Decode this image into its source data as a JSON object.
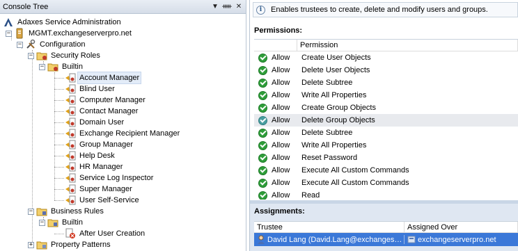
{
  "console_tree": {
    "title": "Console Tree",
    "buttons": {
      "dropdown": "▼",
      "pin": "ᚔ",
      "close": "✕"
    },
    "nodes": [
      {
        "label": "Adaxes Service Administration",
        "icon": "adaxes-logo-icon"
      },
      {
        "label": "MGMT.exchangeserverpro.net",
        "icon": "server-icon"
      },
      {
        "label": "Configuration",
        "icon": "tools-icon"
      },
      {
        "label": "Security Roles",
        "icon": "folder-icon"
      },
      {
        "label": "Builtin",
        "icon": "folder-icon"
      },
      {
        "label": "Account Manager",
        "icon": "role-icon"
      },
      {
        "label": "Blind User",
        "icon": "role-icon"
      },
      {
        "label": "Computer Manager",
        "icon": "role-icon"
      },
      {
        "label": "Contact Manager",
        "icon": "role-icon"
      },
      {
        "label": "Domain User",
        "icon": "role-icon"
      },
      {
        "label": "Exchange Recipient Manager",
        "icon": "role-icon"
      },
      {
        "label": "Group Manager",
        "icon": "role-icon"
      },
      {
        "label": "Help Desk",
        "icon": "role-icon"
      },
      {
        "label": "HR Manager",
        "icon": "role-icon"
      },
      {
        "label": "Service Log Inspector",
        "icon": "role-icon"
      },
      {
        "label": "Super Manager",
        "icon": "role-icon"
      },
      {
        "label": "User Self-Service",
        "icon": "role-icon"
      },
      {
        "label": "Business Rules",
        "icon": "folder-icon"
      },
      {
        "label": "Builtin",
        "icon": "folder-icon"
      },
      {
        "label": "After User Creation",
        "icon": "rule-icon"
      },
      {
        "label": "Property Patterns",
        "icon": "folder-icon"
      }
    ]
  },
  "info_bar": {
    "text": "Enables trustees to create, delete and modify users and groups.",
    "icon": "info-icon"
  },
  "permissions": {
    "title": "Permissions:",
    "column": "Permission",
    "rows": [
      {
        "access": "Allow",
        "permission": "Create User Objects"
      },
      {
        "access": "Allow",
        "permission": "Delete User Objects"
      },
      {
        "access": "Allow",
        "permission": "Delete Subtree"
      },
      {
        "access": "Allow",
        "permission": "Write All Properties"
      },
      {
        "access": "Allow",
        "permission": "Create Group Objects"
      },
      {
        "access": "Allow",
        "permission": "Delete Group Objects"
      },
      {
        "access": "Allow",
        "permission": "Delete Subtree"
      },
      {
        "access": "Allow",
        "permission": "Write All Properties"
      },
      {
        "access": "Allow",
        "permission": "Reset Password"
      },
      {
        "access": "Allow",
        "permission": "Execute All Custom Commands"
      },
      {
        "access": "Allow",
        "permission": "Execute All Custom Commands"
      },
      {
        "access": "Allow",
        "permission": "Read"
      }
    ]
  },
  "assignments": {
    "title": "Assignments:",
    "columns": {
      "trustee": "Trustee",
      "assigned_over": "Assigned Over"
    },
    "rows": [
      {
        "trustee": "David Lang (David.Lang@exchangeserverpro.net)",
        "assigned_over": "exchangeserverpro.net"
      }
    ]
  },
  "colors": {
    "selection": "#3b78d8",
    "allow_check": "#2f9e3a",
    "panel_border": "#b9c5d3"
  }
}
